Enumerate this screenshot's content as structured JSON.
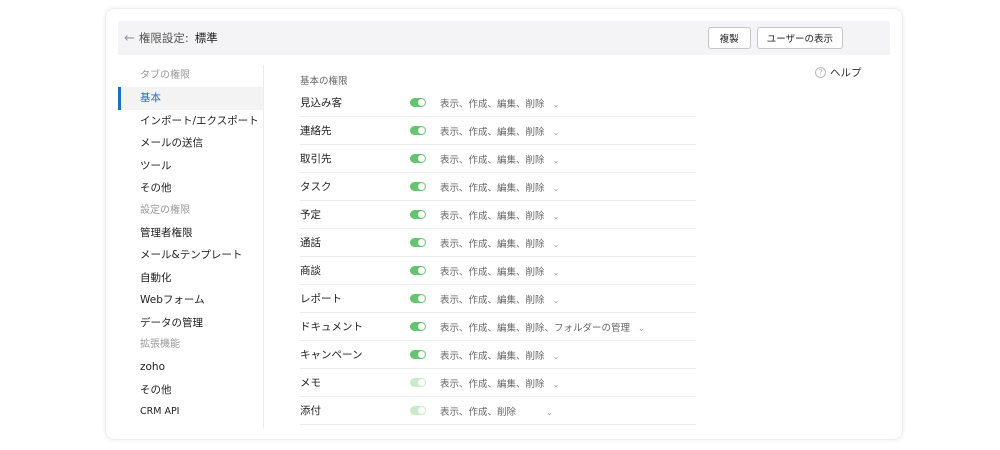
{
  "header": {
    "back_icon": "arrow-left-icon",
    "label": "権限設定:",
    "value": "標準",
    "copy_button": "複製",
    "show_users_button": "ユーザーの表示"
  },
  "sidebar": {
    "group_tab": "タブの権限",
    "items_tab": [
      "基本",
      "インポート/エクスポート",
      "メールの送信",
      "ツール",
      "その他"
    ],
    "group_settings": "設定の権限",
    "items_settings": [
      "管理者権限",
      "メール&テンプレート",
      "自動化",
      "Webフォーム",
      "データの管理"
    ],
    "group_ext": "拡張機能",
    "items_ext": [
      "zoho",
      "その他",
      "CRM API"
    ]
  },
  "content": {
    "section_title": "基本の権限",
    "help_label": "ヘルプ",
    "rows": [
      {
        "label": "見込み客",
        "perms": "表示、作成、編集、削除"
      },
      {
        "label": "連絡先",
        "perms": "表示、作成、編集、削除"
      },
      {
        "label": "取引先",
        "perms": "表示、作成、編集、削除"
      },
      {
        "label": "タスク",
        "perms": "表示、作成、編集、削除"
      },
      {
        "label": "予定",
        "perms": "表示、作成、編集、削除"
      },
      {
        "label": "通話",
        "perms": "表示、作成、編集、削除"
      },
      {
        "label": "商談",
        "perms": "表示、作成、編集、削除"
      },
      {
        "label": "レポート",
        "perms": "表示、作成、編集、削除"
      },
      {
        "label": "ドキュメント",
        "perms": "表示、作成、編集、削除、フォルダーの管理"
      },
      {
        "label": "キャンペーン",
        "perms": "表示、作成、編集、削除"
      },
      {
        "label": "メモ",
        "perms": "表示、作成、編集、削除"
      },
      {
        "label": "添付",
        "perms": "表示、作成、削除"
      }
    ]
  },
  "colors": {
    "accent": "#1a6fc7",
    "toggle_on": "#66c36f",
    "toggle_light": "#c8ebcb"
  }
}
